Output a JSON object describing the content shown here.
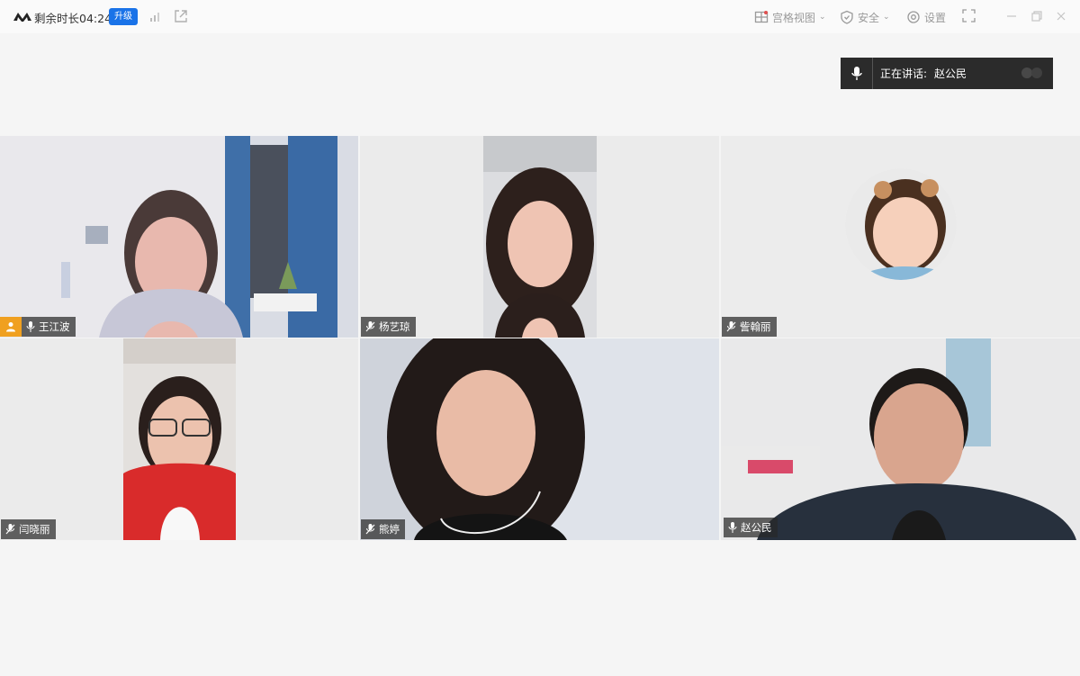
{
  "titlebar": {
    "remaining_time": "剩余时长04:24",
    "upgrade_label": "升级",
    "view_label": "宫格视图",
    "security_label": "安全",
    "settings_label": "设置"
  },
  "speaking": {
    "label": "正在讲话:",
    "name": "赵公民"
  },
  "participants": [
    {
      "name": "王江波",
      "is_host": true
    },
    {
      "name": "杨艺琼"
    },
    {
      "name": "訾翰丽"
    },
    {
      "name": "闫晓丽"
    },
    {
      "name": "熊婷"
    },
    {
      "name": "赵公民",
      "is_active_speaker": true
    }
  ],
  "colors": {
    "accent": "#1a73e8",
    "active_border": "#35c08a",
    "host_badge": "#f0a020"
  }
}
